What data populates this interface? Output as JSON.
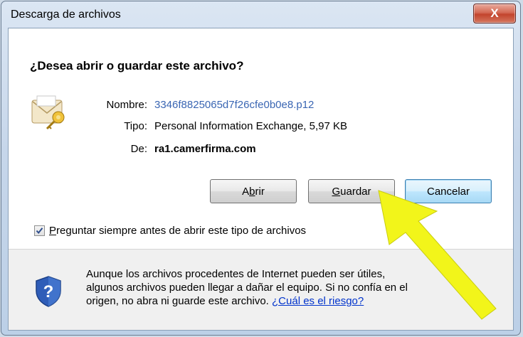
{
  "window": {
    "title": "Descarga de archivos",
    "close_glyph": "X"
  },
  "dialog": {
    "question": "¿Desea abrir o guardar este archivo?",
    "file_icon": "certificate-file-icon",
    "fields": {
      "name_label": "Nombre:",
      "name_value": "3346f8825065d7f26cfe0b0e8.p12",
      "type_label": "Tipo:",
      "type_value": "Personal Information Exchange, 5,97 KB",
      "from_label": "De:",
      "from_value": "ra1.camerfirma.com"
    },
    "buttons": {
      "open_prefix": "A",
      "open_underline": "b",
      "open_suffix": "rir",
      "save_underline": "G",
      "save_suffix": "uardar",
      "cancel_label": "Cancelar"
    },
    "checkbox": {
      "checked": true,
      "label_underline": "P",
      "label_suffix": "reguntar siempre antes de abrir este tipo de archivos"
    },
    "warning": {
      "icon": "shield-question-icon",
      "text": "Aunque los archivos procedentes de Internet pueden ser útiles, algunos archivos pueden llegar a dañar el equipo. Si no confía en el origen, no abra ni guarde este archivo.",
      "link": "¿Cuál es el riesgo?"
    }
  },
  "annotation": {
    "arrow_color": "#f2f51a",
    "arrow_icon": "pointer-arrow-icon"
  }
}
